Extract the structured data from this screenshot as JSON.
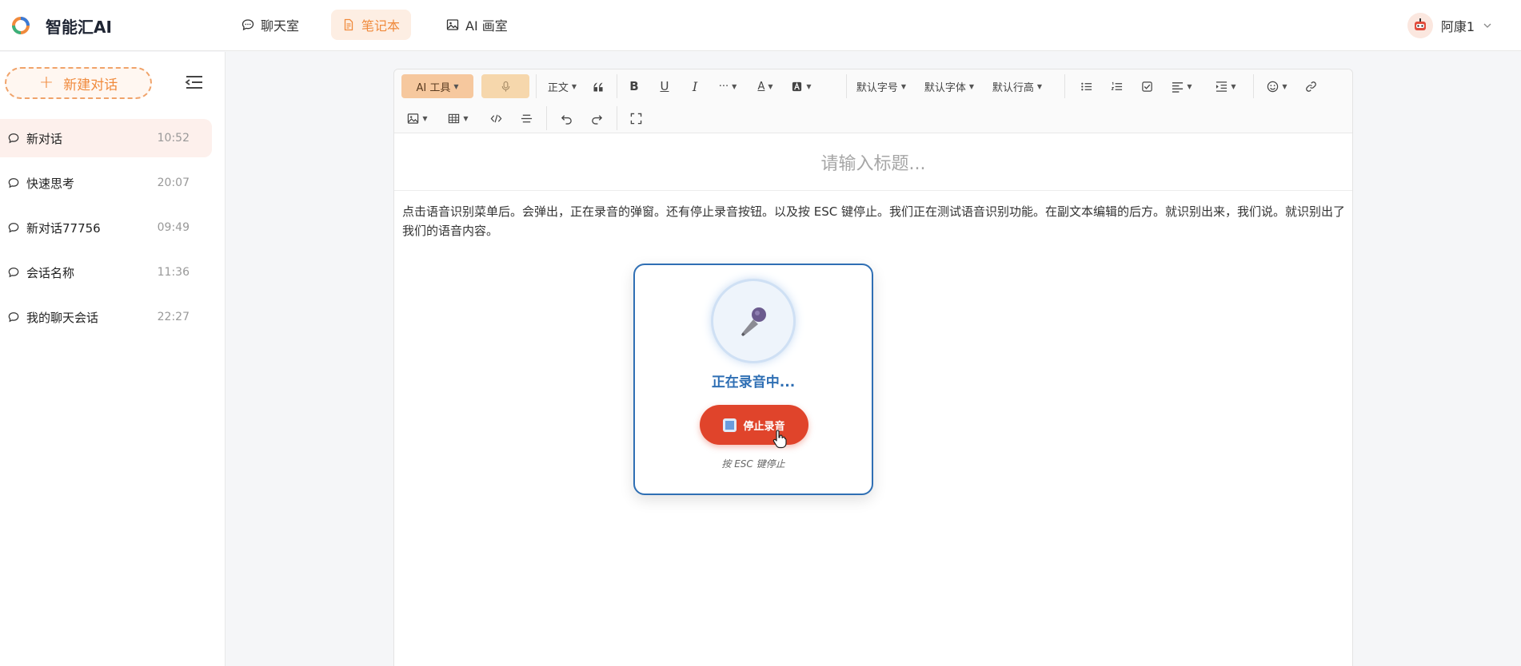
{
  "app": {
    "title": "智能汇AI"
  },
  "nav": {
    "tabs": [
      {
        "label": "聊天室",
        "icon": "chat-bubble-icon"
      },
      {
        "label": "笔记本",
        "icon": "document-icon"
      },
      {
        "label": "AI 画室",
        "icon": "image-icon"
      }
    ],
    "active_index": 1
  },
  "user": {
    "name": "阿康1"
  },
  "sidebar": {
    "new_chat_label": "新建对话",
    "conversations": [
      {
        "name": "新对话",
        "time": "10:52",
        "active": true
      },
      {
        "name": "快速思考",
        "time": "20:07"
      },
      {
        "name": "新对话77756",
        "time": "09:49"
      },
      {
        "name": "会话名称",
        "time": "11:36"
      },
      {
        "name": "我的聊天会话",
        "time": "22:27"
      }
    ]
  },
  "toolbar": {
    "ai_tools_label": "AI 工具",
    "heading_label": "正文",
    "font_size_label": "默认字号",
    "font_family_label": "默认字体",
    "line_height_label": "默认行高",
    "more_label": "···"
  },
  "editor": {
    "title_placeholder": "请输入标题...",
    "content": "点击语音识别菜单后。会弹出，正在录音的弹窗。还有停止录音按钮。以及按 ESC 键停止。我们正在测试语音识别功能。在副文本编辑的后方。就识别出来，我们说。就识别出了我们的语音内容。"
  },
  "recording": {
    "status": "正在录音中...",
    "stop_label": "停止录音",
    "hint": "按 ESC 键停止"
  },
  "colors": {
    "accent": "#f08a3c",
    "record_red": "#e0442b",
    "record_blue": "#2f6fb4"
  }
}
